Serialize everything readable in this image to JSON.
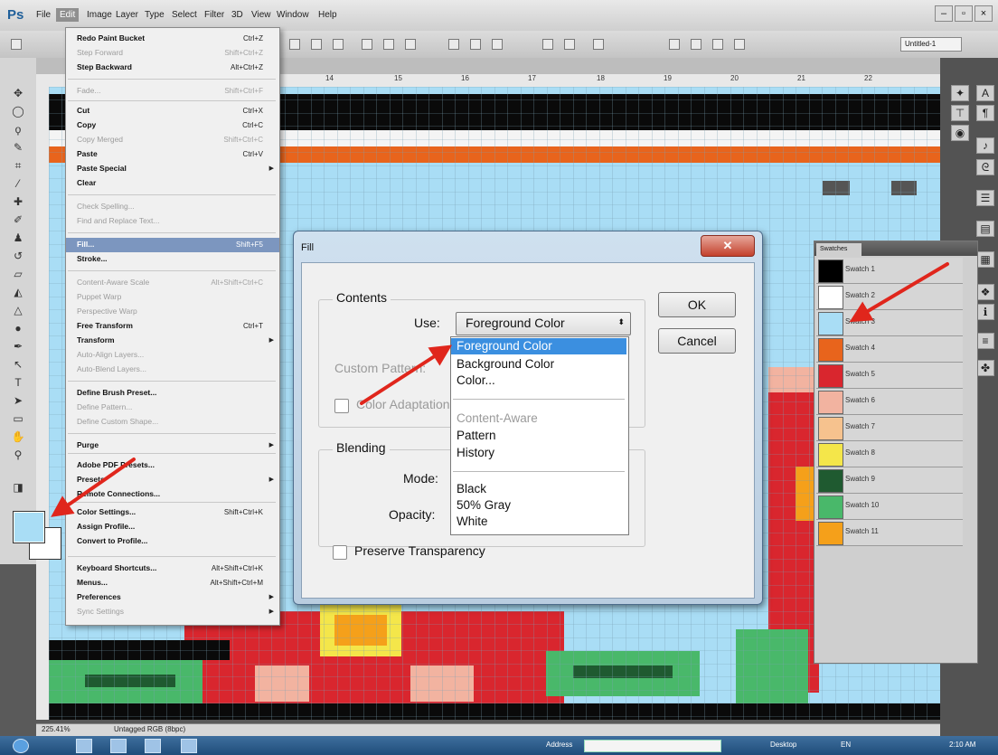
{
  "app": {
    "logo": "Ps"
  },
  "menubar": {
    "items": [
      "File",
      "Edit",
      "Image",
      "Layer",
      "Type",
      "Select",
      "Filter",
      "3D",
      "View",
      "Window",
      "Help"
    ]
  },
  "window_controls": {
    "minimize": "–",
    "maximize": "▫",
    "close": "×"
  },
  "options_bar": {
    "document_field": "Untitled-1"
  },
  "ruler": {
    "labels": [
      "14",
      "15",
      "16",
      "17",
      "18",
      "19",
      "20",
      "21",
      "22"
    ]
  },
  "edit_menu": {
    "items": [
      {
        "label": "Redo Paint Bucket",
        "shortcut": "Ctrl+Z",
        "enabled": true
      },
      {
        "label": "Step Forward",
        "shortcut": "Shift+Ctrl+Z",
        "enabled": false
      },
      {
        "label": "Step Backward",
        "shortcut": "Alt+Ctrl+Z",
        "enabled": true
      },
      {
        "label": "Fade...",
        "shortcut": "Shift+Ctrl+F",
        "enabled": false
      },
      {
        "label": "Cut",
        "shortcut": "Ctrl+X",
        "enabled": true
      },
      {
        "label": "Copy",
        "shortcut": "Ctrl+C",
        "enabled": true
      },
      {
        "label": "Copy Merged",
        "shortcut": "Shift+Ctrl+C",
        "enabled": false
      },
      {
        "label": "Paste",
        "shortcut": "Ctrl+V",
        "enabled": true
      },
      {
        "label": "Paste Special",
        "shortcut": "",
        "enabled": true,
        "submenu": true
      },
      {
        "label": "Clear",
        "shortcut": "",
        "enabled": true
      },
      {
        "label": "Check Spelling...",
        "shortcut": "",
        "enabled": false
      },
      {
        "label": "Find and Replace Text...",
        "shortcut": "",
        "enabled": false
      },
      {
        "label": "Fill...",
        "shortcut": "Shift+F5",
        "enabled": true,
        "highlighted": true
      },
      {
        "label": "Stroke...",
        "shortcut": "",
        "enabled": true
      },
      {
        "label": "Content-Aware Scale",
        "shortcut": "Alt+Shift+Ctrl+C",
        "enabled": false
      },
      {
        "label": "Puppet Warp",
        "shortcut": "",
        "enabled": false
      },
      {
        "label": "Perspective Warp",
        "shortcut": "",
        "enabled": false
      },
      {
        "label": "Free Transform",
        "shortcut": "Ctrl+T",
        "enabled": true
      },
      {
        "label": "Transform",
        "shortcut": "",
        "enabled": true,
        "submenu": true
      },
      {
        "label": "Auto-Align Layers...",
        "shortcut": "",
        "enabled": false
      },
      {
        "label": "Auto-Blend Layers...",
        "shortcut": "",
        "enabled": false
      },
      {
        "label": "Define Brush Preset...",
        "shortcut": "",
        "enabled": true
      },
      {
        "label": "Define Pattern...",
        "shortcut": "",
        "enabled": false
      },
      {
        "label": "Define Custom Shape...",
        "shortcut": "",
        "enabled": false
      },
      {
        "label": "Purge",
        "shortcut": "",
        "enabled": true,
        "submenu": true
      },
      {
        "label": "Adobe PDF Presets...",
        "shortcut": "",
        "enabled": true
      },
      {
        "label": "Presets",
        "shortcut": "",
        "enabled": true,
        "submenu": true
      },
      {
        "label": "Remote Connections...",
        "shortcut": "",
        "enabled": true
      },
      {
        "label": "Color Settings...",
        "shortcut": "Shift+Ctrl+K",
        "enabled": true
      },
      {
        "label": "Assign Profile...",
        "shortcut": "",
        "enabled": true
      },
      {
        "label": "Convert to Profile...",
        "shortcut": "",
        "enabled": true
      },
      {
        "label": "Keyboard Shortcuts...",
        "shortcut": "Alt+Shift+Ctrl+K",
        "enabled": true
      },
      {
        "label": "Menus...",
        "shortcut": "Alt+Shift+Ctrl+M",
        "enabled": true
      },
      {
        "label": "Preferences",
        "shortcut": "",
        "enabled": true,
        "submenu": true
      },
      {
        "label": "Sync Settings",
        "shortcut": "",
        "enabled": false,
        "submenu": true
      }
    ]
  },
  "fill_dialog": {
    "title": "Fill",
    "close": "✕",
    "contents_group": "Contents",
    "use_label": "Use:",
    "use_value": "Foreground Color",
    "custom_pattern_label": "Custom Pattern:",
    "color_adaptation_label": "Color Adaptation",
    "blending_group": "Blending",
    "mode_label": "Mode:",
    "opacity_label": "Opacity:",
    "preserve_label": "Preserve Transparency",
    "ok": "OK",
    "cancel": "Cancel",
    "dropdown_options": [
      {
        "label": "Foreground Color",
        "selected": true,
        "enabled": true
      },
      {
        "label": "Background Color",
        "enabled": true
      },
      {
        "label": "Color...",
        "enabled": true
      },
      {
        "label": "Content-Aware",
        "enabled": false
      },
      {
        "label": "Pattern",
        "enabled": true
      },
      {
        "label": "History",
        "enabled": true
      },
      {
        "label": "Black",
        "enabled": true
      },
      {
        "label": "50% Gray",
        "enabled": true
      },
      {
        "label": "White",
        "enabled": true
      }
    ]
  },
  "swatches_panel": {
    "tab": "Swatches",
    "swatches": [
      {
        "name": "Swatch 1",
        "color": "#000000"
      },
      {
        "name": "Swatch 2",
        "color": "#ffffff"
      },
      {
        "name": "Swatch 3",
        "color": "#a9ddf5"
      },
      {
        "name": "Swatch 4",
        "color": "#e8641c"
      },
      {
        "name": "Swatch 5",
        "color": "#d9262e"
      },
      {
        "name": "Swatch 6",
        "color": "#f2b3a0"
      },
      {
        "name": "Swatch 7",
        "color": "#f6c28e"
      },
      {
        "name": "Swatch 8",
        "color": "#f4e64a"
      },
      {
        "name": "Swatch 9",
        "color": "#1f5a30"
      },
      {
        "name": "Swatch 10",
        "color": "#49b86a"
      },
      {
        "name": "Swatch 11",
        "color": "#f5a01a"
      }
    ]
  },
  "status_bar": {
    "zoom": "225.41%",
    "doc_info": "Untagged RGB (8bpc)"
  },
  "taskbar": {
    "address_label": "Address",
    "desktop_label": "Desktop",
    "lang": "EN",
    "time": "2:10 AM"
  },
  "colors": {
    "foreground": "#a9ddf5",
    "background": "#ffffff",
    "accent_highlight": "#3b8fe0",
    "annotation_arrow": "#e0261c"
  }
}
